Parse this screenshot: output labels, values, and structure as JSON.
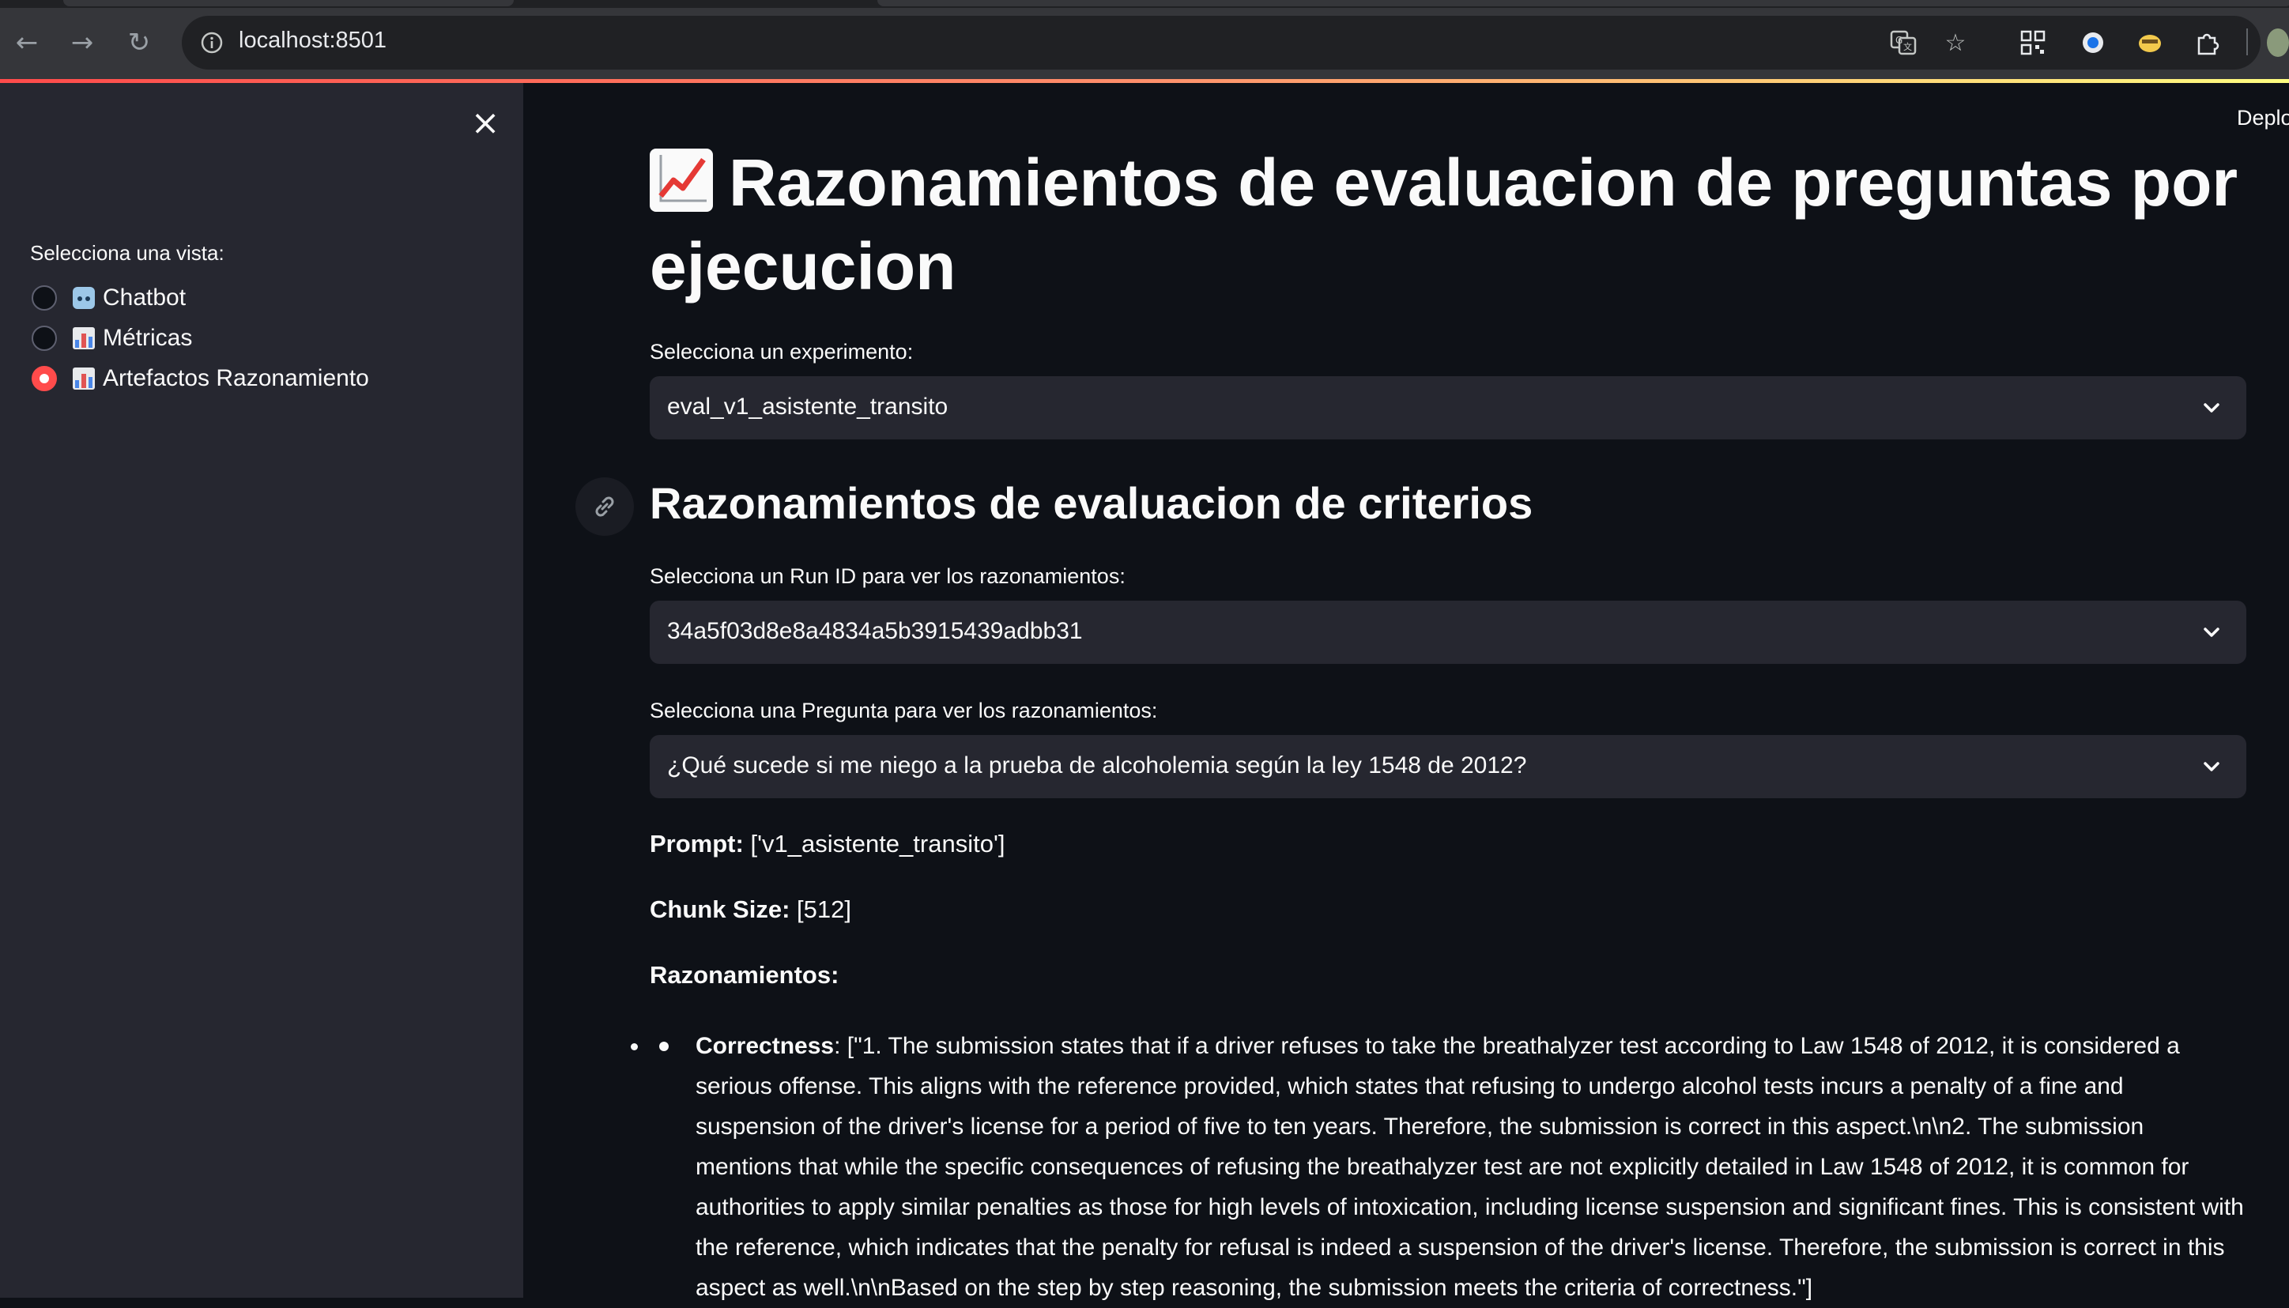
{
  "browser": {
    "url": "localhost:8501"
  },
  "sidebar": {
    "radio_title": "Selecciona una vista:",
    "options": [
      {
        "label": "Chatbot",
        "icon": "robot-icon",
        "selected": false
      },
      {
        "label": "Métricas",
        "icon": "bar-chart-icon",
        "selected": false
      },
      {
        "label": "Artefactos Razonamiento",
        "icon": "bar-chart-icon",
        "selected": true
      }
    ]
  },
  "header": {
    "deploy_label": "Deplo"
  },
  "main": {
    "title": "Razonamientos de evaluacion de preguntas por ejecucion",
    "experiment": {
      "label": "Selecciona un experimento:",
      "value": "eval_v1_asistente_transito"
    },
    "section_title": "Razonamientos de evaluacion de criterios",
    "run_id": {
      "label": "Selecciona un Run ID para ver los razonamientos:",
      "value": "34a5f03d8e8a4834a5b3915439adbb31"
    },
    "question": {
      "label": "Selecciona una Pregunta para ver los razonamientos:",
      "value": "¿Qué sucede si me niego a la prueba de alcoholemia según la ley 1548 de 2012?"
    },
    "prompt": {
      "key": "Prompt:",
      "value": "['v1_asistente_transito']"
    },
    "chunk_size": {
      "key": "Chunk Size:",
      "value": "[512]"
    },
    "reasonings_title": "Razonamientos:",
    "reasonings": [
      {
        "key": "Correctness",
        "text": ": [\"1. The submission states that if a driver refuses to take the breathalyzer test according to Law 1548 of 2012, it is considered a serious offense. This aligns with the reference provided, which states that refusing to undergo alcohol tests incurs a penalty of a fine and suspension of the driver's license for a period of five to ten years. Therefore, the submission is correct in this aspect.\\n\\n2. The submission mentions that while the specific consequences of refusing the breathalyzer test are not explicitly detailed in Law 1548 of 2012, it is common for authorities to apply similar penalties as those for high levels of intoxication, including license suspension and significant fines. This is consistent with the reference, which indicates that the penalty for refusal is indeed a suspension of the driver's license. Therefore, the submission is correct in this aspect as well.\\n\\nBased on the step by step reasoning, the submission meets the criteria of correctness.\"]"
      }
    ]
  },
  "colors": {
    "accent": "#ff4b4b",
    "background": "#0e1117",
    "sidebar_bg": "#262730",
    "input_bg": "#262730"
  }
}
